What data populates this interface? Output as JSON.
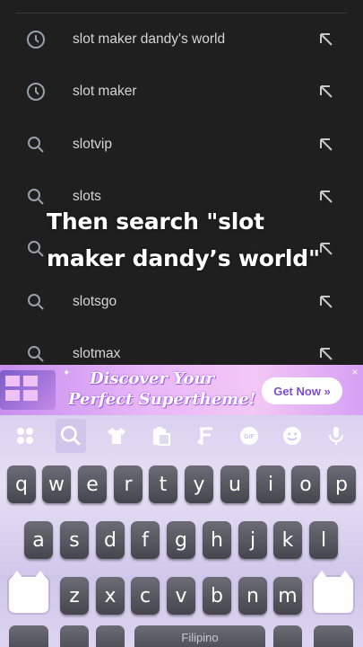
{
  "suggestions": [
    {
      "label": "slot maker dandy's world",
      "icon": "history-icon"
    },
    {
      "label": "slot maker",
      "icon": "history-icon"
    },
    {
      "label": "slotvip",
      "icon": "search-icon"
    },
    {
      "label": "slots",
      "icon": "search-icon"
    },
    {
      "label": "slotsbch",
      "icon": "search-icon"
    },
    {
      "label": "slotsgo",
      "icon": "search-icon"
    },
    {
      "label": "slotmax",
      "icon": "search-icon"
    }
  ],
  "overlay": {
    "line1": "Then search \"slot",
    "line2": "maker dandy’s world\""
  },
  "ad": {
    "line1": "Discover Your",
    "line2": "Perfect Supertheme!",
    "cta": "Get Now »",
    "close": "×"
  },
  "keyboard": {
    "toolbar": [
      "apps-icon",
      "search-icon",
      "shirt-icon",
      "clipboard-icon",
      "font-icon",
      "gif-icon",
      "emoji-icon",
      "mic-icon"
    ],
    "row1": [
      "q",
      "w",
      "e",
      "r",
      "t",
      "y",
      "u",
      "i",
      "o",
      "p"
    ],
    "row2": [
      "a",
      "s",
      "d",
      "f",
      "g",
      "h",
      "j",
      "k",
      "l"
    ],
    "row3": [
      "z",
      "x",
      "c",
      "v",
      "b",
      "n",
      "m"
    ],
    "space_label": "Filipino"
  },
  "colors": {
    "background": "#1f1f1f",
    "text": "#d5d5d5",
    "key": "#55555e"
  }
}
